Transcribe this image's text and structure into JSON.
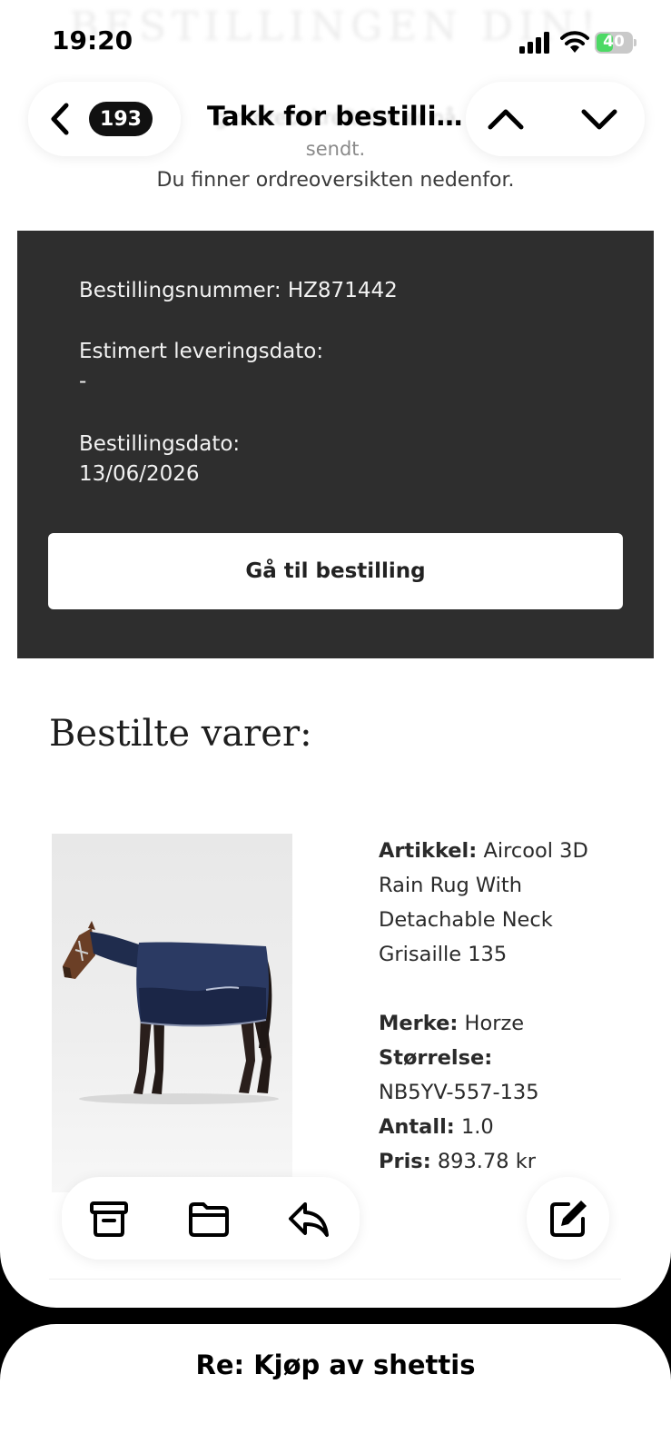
{
  "status_bar": {
    "time": "19:20",
    "battery": "40"
  },
  "header": {
    "unread_count": "193",
    "subject": "Takk for bestilli…"
  },
  "email": {
    "ghost_heading": "BESTILLINGEN DIN!",
    "ghost_line1": "g ordrebekreftelse er nå",
    "ghost_line2": "sendt.",
    "intro": "Du finner ordreoversikten nedenfor.",
    "order": {
      "number_line": "Bestillingsnummer: HZ871442",
      "delivery_label": "Estimert leveringsdato:",
      "delivery_value": "-",
      "date_label": "Bestillingsdato:",
      "date_value": "13/06/2026",
      "button": "Gå til bestilling"
    },
    "items_title": "Bestilte varer:",
    "product": {
      "article_label": "Artikkel:",
      "article_line1": "Aircool 3D",
      "article_line2": "Rain Rug With",
      "article_line3": "Detachable Neck",
      "article_line4": "Grisaille 135",
      "brand_label": "Merke:",
      "brand_value": "Horze",
      "size_label": "Størrelse:",
      "size_value": "NB5YV-557-135",
      "qty_label": "Antall:",
      "qty_value": "1.0",
      "price_label": "Pris:",
      "price_value": "893.78 kr"
    }
  },
  "toolbar": {
    "icons": [
      "archive-icon",
      "folder-icon",
      "reply-icon",
      "compose-icon"
    ]
  },
  "next_mail": {
    "subject": "Re: Kjøp av shettis"
  },
  "colors": {
    "order_box": "#2e2e2e",
    "rug_navy": "#26355a",
    "battery_green": "#4cd964"
  }
}
